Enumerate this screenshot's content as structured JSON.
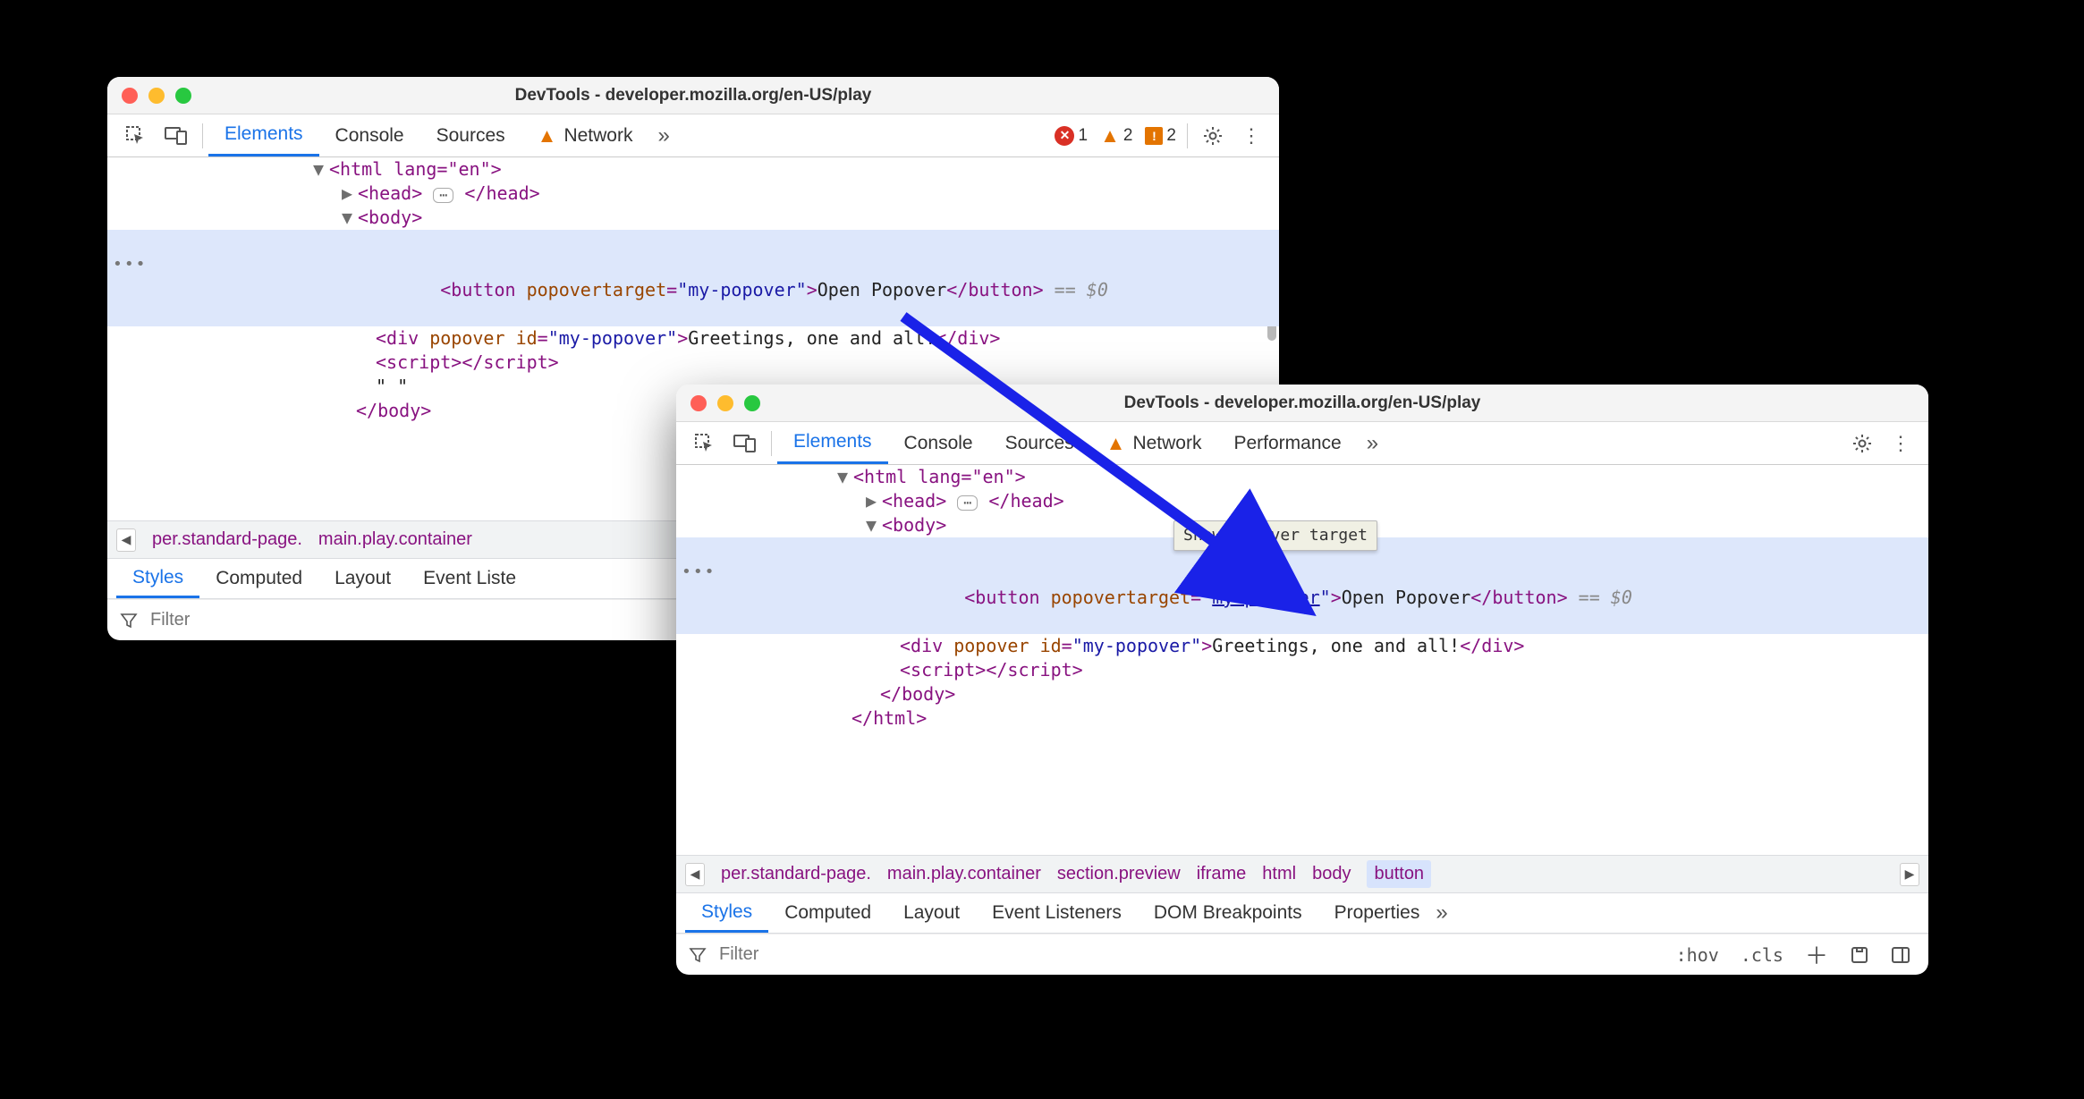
{
  "w1": {
    "title": "DevTools - developer.mozilla.org/en-US/play",
    "tabs": [
      "Elements",
      "Console",
      "Sources",
      "Network"
    ],
    "activeTab": 0,
    "networkHasWarning": true,
    "counts": {
      "errors": "1",
      "warnings": "2",
      "issues": "2"
    },
    "dom": {
      "htmlOpen": "<html lang=\"en\">",
      "headOpen": "<head>",
      "headClose": "</head>",
      "bodyOpen": "<body>",
      "buttonLine": {
        "prefix": "<button popovertarget=\"",
        "val": "my-popover",
        "suffix": "\">",
        "text": "Open Popover",
        "close": "</button>",
        "eq": " == ",
        "dollar": "$0"
      },
      "divLine": "<div popover id=\"my-popover\">Greetings, one and all!</div>",
      "scriptLine": "<script></script>",
      "quoteLine": "\" \"",
      "bodyClose": "</body>"
    },
    "crumbs": [
      "per.standard-page.",
      "main.play.container"
    ],
    "subtabs": [
      "Styles",
      "Computed",
      "Layout",
      "Event Liste"
    ],
    "filterPlaceholder": "Filter"
  },
  "w2": {
    "title": "DevTools - developer.mozilla.org/en-US/play",
    "tabs": [
      "Elements",
      "Console",
      "Sources",
      "Network",
      "Performance"
    ],
    "activeTab": 0,
    "networkHasWarning": true,
    "dom": {
      "htmlOpen": "<html lang=\"en\">",
      "headOpen": "<head>",
      "headClose": "</head>",
      "bodyOpen": "<body>",
      "buttonLine": {
        "prefix": "<button popovertarget=\"",
        "val": "my-popover",
        "suffix": "\">",
        "text": "Open Popover",
        "close": "</button>",
        "eq": " == ",
        "dollar": "$0"
      },
      "divLine": "<div popover id=\"my-popover\">Greetings, one and all!</div>",
      "scriptLine": "<script></script>",
      "bodyClose": "</body>",
      "htmlClose": "</html>"
    },
    "tooltip": "Show popover target",
    "crumbs": [
      "per.standard-page.",
      "main.play.container",
      "section.preview",
      "iframe",
      "html",
      "body",
      "button"
    ],
    "subtabs": [
      "Styles",
      "Computed",
      "Layout",
      "Event Listeners",
      "DOM Breakpoints",
      "Properties"
    ],
    "filterPlaceholder": "Filter",
    "filterTools": {
      "hov": ":hov",
      "cls": ".cls"
    }
  },
  "colors": {
    "activeBlue": "#1a73e8",
    "tagColor": "#881280",
    "attrName": "#994500",
    "attrVal": "#1a1aa6",
    "selection": "#dde7fb",
    "arrow": "#1a22e8"
  }
}
